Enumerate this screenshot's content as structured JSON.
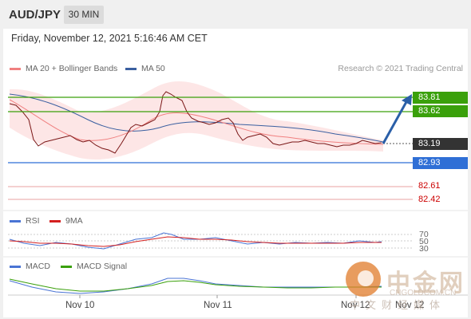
{
  "header": {
    "symbol": "AUD/JPY",
    "interval": "30 MIN"
  },
  "timestamp": "Friday, November 12, 2021 5:16:46 AM CET",
  "legend": {
    "bollinger": {
      "label": "MA 20 + Bollinger Bands",
      "color": "#f08080"
    },
    "ma50": {
      "label": "MA 50",
      "color": "#3a5fa0"
    },
    "research": "Research © 2021 Trading Central"
  },
  "levels": [
    {
      "value": "83.81",
      "color": "#3aa00b"
    },
    {
      "value": "83.62",
      "color": "#3aa00b"
    },
    {
      "value": "83.19",
      "color": "#333333"
    },
    {
      "value": "82.93",
      "color": "#2f6fd6"
    },
    {
      "value": "82.61",
      "color": "#cc0000"
    },
    {
      "value": "82.42",
      "color": "#cc0000"
    }
  ],
  "rsi": {
    "label": "RSI",
    "signal_label": "9MA",
    "levels": [
      "70",
      "50",
      "30"
    ]
  },
  "macd": {
    "label": "MACD",
    "signal_label": "MACD Signal"
  },
  "dates": [
    "Nov 10",
    "Nov 11",
    "Nov 12",
    "Nov 12"
  ],
  "watermark": {
    "logo_text": "中金网",
    "sub_text": "中文财经媒体",
    "url": "CNGOLDCOM.CN"
  }
}
